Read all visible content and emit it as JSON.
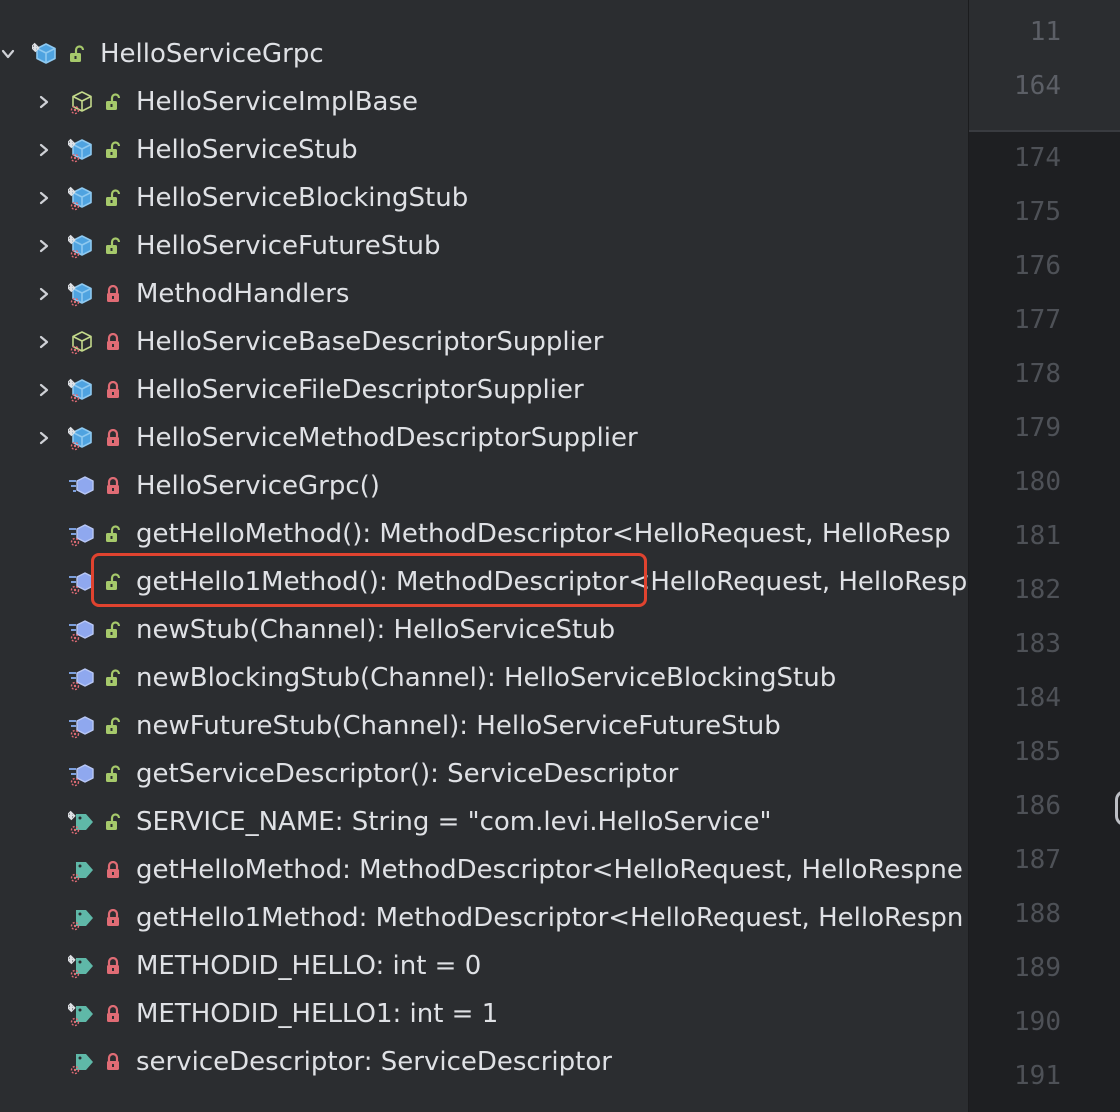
{
  "colors": {
    "panel_bg": "#2b2d30",
    "gutter_bg": "#1e1f22",
    "text": "#dfe1e5",
    "line_number": "#4e5157",
    "lock_public": "#a6c96b",
    "lock_private": "#e06c75",
    "class_icon": "#4fa3e0",
    "interface_icon": "#c3d98a",
    "field_icon": "#5fb8a8",
    "highlight_box": "#e0432f"
  },
  "tree": {
    "root": {
      "label": "HelloServiceGrpc",
      "icon": "class-icon",
      "visibility": "public"
    },
    "items": [
      {
        "label": "HelloServiceImplBase",
        "icon": "abstract-class-icon",
        "visibility": "public",
        "expandable": true
      },
      {
        "label": "HelloServiceStub",
        "icon": "static-class-icon",
        "visibility": "public",
        "expandable": true
      },
      {
        "label": "HelloServiceBlockingStub",
        "icon": "static-class-icon",
        "visibility": "public",
        "expandable": true
      },
      {
        "label": "HelloServiceFutureStub",
        "icon": "static-class-icon",
        "visibility": "public",
        "expandable": true
      },
      {
        "label": "MethodHandlers",
        "icon": "static-class-icon",
        "visibility": "private",
        "expandable": true
      },
      {
        "label": "HelloServiceBaseDescriptorSupplier",
        "icon": "abstract-class-icon",
        "visibility": "private",
        "expandable": true
      },
      {
        "label": "HelloServiceFileDescriptorSupplier",
        "icon": "static-class-icon",
        "visibility": "private",
        "expandable": true
      },
      {
        "label": "HelloServiceMethodDescriptorSupplier",
        "icon": "static-class-icon",
        "visibility": "private",
        "expandable": true
      },
      {
        "label": "HelloServiceGrpc()",
        "icon": "constructor-icon",
        "visibility": "private",
        "expandable": false
      },
      {
        "label": "getHelloMethod(): MethodDescriptor<HelloRequest, HelloResp",
        "icon": "static-method-icon",
        "visibility": "public",
        "expandable": false
      },
      {
        "label": "getHello1Method(): MethodDescriptor<HelloRequest, HelloResp",
        "icon": "static-method-icon",
        "visibility": "public",
        "expandable": false,
        "highlighted": true
      },
      {
        "label": "newStub(Channel): HelloServiceStub",
        "icon": "static-method-icon",
        "visibility": "public",
        "expandable": false
      },
      {
        "label": "newBlockingStub(Channel): HelloServiceBlockingStub",
        "icon": "static-method-icon",
        "visibility": "public",
        "expandable": false
      },
      {
        "label": "newFutureStub(Channel): HelloServiceFutureStub",
        "icon": "static-method-icon",
        "visibility": "public",
        "expandable": false
      },
      {
        "label": "getServiceDescriptor(): ServiceDescriptor",
        "icon": "static-method-icon",
        "visibility": "public",
        "expandable": false
      },
      {
        "label": "SERVICE_NAME: String = \"com.levi.HelloService\"",
        "icon": "static-final-field-icon",
        "visibility": "public",
        "expandable": false
      },
      {
        "label": "getHelloMethod: MethodDescriptor<HelloRequest, HelloRespne",
        "icon": "static-field-icon",
        "visibility": "private",
        "expandable": false
      },
      {
        "label": "getHello1Method: MethodDescriptor<HelloRequest, HelloRespn",
        "icon": "static-field-icon",
        "visibility": "private",
        "expandable": false
      },
      {
        "label": "METHODID_HELLO: int = 0",
        "icon": "static-final-field-icon",
        "visibility": "private",
        "expandable": false
      },
      {
        "label": "METHODID_HELLO1: int = 1",
        "icon": "static-final-field-icon",
        "visibility": "private",
        "expandable": false
      },
      {
        "label": "serviceDescriptor: ServiceDescriptor",
        "icon": "static-field-icon",
        "visibility": "private",
        "expandable": false
      }
    ]
  },
  "gutter": {
    "sticky_lines": [
      "11",
      "164"
    ],
    "lines": [
      "174",
      "175",
      "176",
      "177",
      "178",
      "179",
      "180",
      "181",
      "182",
      "183",
      "184",
      "185",
      "186",
      "187",
      "188",
      "189",
      "190",
      "191"
    ]
  }
}
